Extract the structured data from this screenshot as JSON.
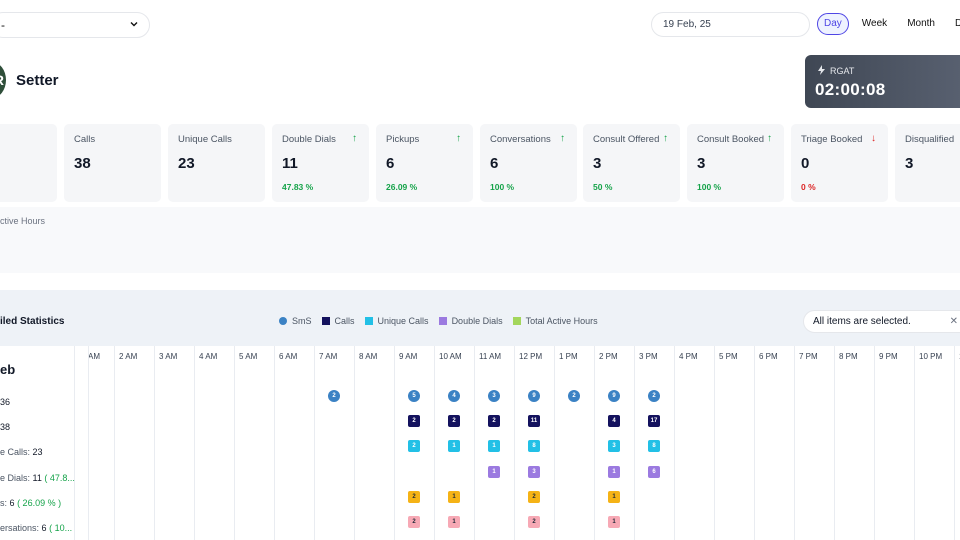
{
  "top": {
    "select_value": "-",
    "date_value": "19 Feb, 25",
    "ranges": [
      "Day",
      "Week",
      "Month",
      "Date"
    ]
  },
  "profile": {
    "avatar_initial": "R",
    "name": "Setter"
  },
  "rgat": {
    "label": "RGAT",
    "value": "02:00:08"
  },
  "stats": [
    {
      "title": "Calls",
      "value": "38",
      "pct": "",
      "trend": ""
    },
    {
      "title": "Unique Calls",
      "value": "23",
      "pct": "",
      "trend": ""
    },
    {
      "title": "Double Dials",
      "value": "11",
      "pct": "47.83 %",
      "trend": "up"
    },
    {
      "title": "Pickups",
      "value": "6",
      "pct": "26.09 %",
      "trend": "up"
    },
    {
      "title": "Conversations",
      "value": "6",
      "pct": "100 %",
      "trend": "up"
    },
    {
      "title": "Consult Offered",
      "value": "3",
      "pct": "50 %",
      "trend": "up"
    },
    {
      "title": "Consult Booked",
      "value": "3",
      "pct": "100 %",
      "trend": "up"
    },
    {
      "title": "Triage Booked",
      "value": "0",
      "pct": "0 %",
      "trend": "down"
    },
    {
      "title": "Disqualified",
      "value": "3",
      "pct": "",
      "trend": ""
    }
  ],
  "active_hours_label": "ctive Hours",
  "detail": {
    "title": "iled Statistics",
    "legend": [
      {
        "label": "SmS",
        "color": "#3b82c4",
        "shape": "circle"
      },
      {
        "label": "Calls",
        "color": "#14125e",
        "shape": "square"
      },
      {
        "label": "Unique Calls",
        "color": "#22c0e6",
        "shape": "square"
      },
      {
        "label": "Double Dials",
        "color": "#9b7ae0",
        "shape": "square"
      },
      {
        "label": "Total Active Hours",
        "color": "#a3d65c",
        "shape": "square"
      }
    ],
    "filter_text": "All items are selected.",
    "date_heading": "eb",
    "hours": [
      "AM",
      "2 AM",
      "3 AM",
      "4 AM",
      "5 AM",
      "6 AM",
      "7 AM",
      "8 AM",
      "9 AM",
      "10 AM",
      "11 AM",
      "12 PM",
      "1 PM",
      "2 PM",
      "3 PM",
      "4 PM",
      "5 PM",
      "6 PM",
      "7 PM",
      "8 PM",
      "9 PM",
      "10 PM",
      "1"
    ],
    "rows": [
      {
        "label": "",
        "total": "36",
        "pct": "",
        "kind": "sms"
      },
      {
        "label": "",
        "total": "38",
        "pct": "",
        "kind": "calls"
      },
      {
        "label": "e Calls:",
        "total": "23",
        "pct": "",
        "kind": "unique"
      },
      {
        "label": "e Dials:",
        "total": "11",
        "pct": "( 47.8...",
        "kind": "dd"
      },
      {
        "label": "s:",
        "total": "6",
        "pct": "( 26.09 % )",
        "kind": "pick"
      },
      {
        "label": "ersations:",
        "total": "6",
        "pct": "( 10...",
        "kind": "conv"
      }
    ],
    "cells": {
      "sms": [
        [
          7,
          "2"
        ],
        [
          9,
          "5"
        ],
        [
          10,
          "4"
        ],
        [
          11,
          "3"
        ],
        [
          12,
          "9"
        ],
        [
          13,
          "2"
        ],
        [
          14,
          "9"
        ],
        [
          15,
          "2"
        ]
      ],
      "calls": [
        [
          9,
          "2"
        ],
        [
          10,
          "2"
        ],
        [
          11,
          "2"
        ],
        [
          12,
          "11"
        ],
        [
          14,
          "4"
        ],
        [
          15,
          "17"
        ]
      ],
      "unique": [
        [
          9,
          "2"
        ],
        [
          10,
          "1"
        ],
        [
          11,
          "1"
        ],
        [
          12,
          "8"
        ],
        [
          14,
          "3"
        ],
        [
          15,
          "8"
        ]
      ],
      "dd": [
        [
          11,
          "1"
        ],
        [
          12,
          "3"
        ],
        [
          14,
          "1"
        ],
        [
          15,
          "6"
        ]
      ],
      "pick": [
        [
          9,
          "2"
        ],
        [
          10,
          "1"
        ],
        [
          12,
          "2"
        ],
        [
          14,
          "1"
        ]
      ],
      "conv": [
        [
          9,
          "2"
        ],
        [
          10,
          "1"
        ],
        [
          12,
          "2"
        ],
        [
          14,
          "1"
        ]
      ]
    }
  }
}
